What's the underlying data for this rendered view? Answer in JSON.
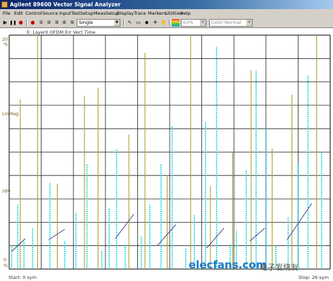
{
  "window": {
    "title": "Agilent 89600 Vector Signal Analyzer"
  },
  "menu": [
    "File",
    "Edit",
    "Control",
    "Source",
    "Input",
    "TestSetup",
    "MeasSetup",
    "Display",
    "Trace",
    "Markers",
    "Utilities",
    "Help"
  ],
  "toolbar": {
    "mode_value": "Single",
    "zoom_value": "63%",
    "color_value": "Color:Normal"
  },
  "trace": {
    "title": "E: Layer0 OFDM Err Vect Time",
    "y_top": "20",
    "y_top_unit": "%",
    "y_ref": "LinMag",
    "y_div": "/div",
    "y_bottom": "0",
    "y_bottom_unit": "%",
    "x_start": "Start: 0  sym",
    "x_stop": "Stop: 26  sym"
  },
  "watermark": {
    "brand": "elecfans.com",
    "cn": "电子发烧友"
  },
  "chart_data": {
    "type": "line",
    "ylim": [
      0,
      20
    ],
    "y_unit": "%",
    "xlim": [
      0,
      26
    ],
    "x_unit": "sym",
    "grid": true,
    "series": [
      {
        "color": "#22d7e0",
        "x": [
          0.2,
          0.7,
          1.2,
          1.9,
          3.3,
          4.5,
          5.4,
          6.3,
          7.5,
          8.1,
          8.7,
          9.4,
          10.7,
          11.4,
          12.3,
          13.2,
          14.3,
          15.0,
          15.9,
          16.8,
          17.9,
          18.4,
          19.2,
          20.0,
          20.8,
          21.6,
          22.6,
          23.4,
          24.2,
          25.3
        ],
        "y": [
          2.0,
          5.5,
          2.4,
          3.5,
          7.4,
          2.4,
          4.8,
          9.0,
          1.6,
          5.2,
          10.3,
          2.1,
          2.8,
          5.5,
          9.0,
          12.2,
          1.8,
          4.6,
          12.6,
          19.0,
          2.1,
          3.3,
          8.5,
          17.0,
          12.0,
          2.0,
          4.5,
          9.0,
          16.6,
          10.0
        ]
      },
      {
        "color": "#b0a030",
        "x": [
          0.9,
          2.3,
          3.9,
          6.1,
          7.2,
          9.7,
          11.0,
          12.8,
          14.7,
          16.3,
          18.1,
          19.6,
          21.3,
          22.9,
          24.9
        ],
        "y": [
          14.5,
          20.0,
          7.3,
          14.8,
          15.5,
          11.5,
          18.5,
          8.0,
          20.0,
          7.1,
          10.0,
          17.0,
          10.3,
          14.9,
          20.0
        ]
      }
    ]
  }
}
